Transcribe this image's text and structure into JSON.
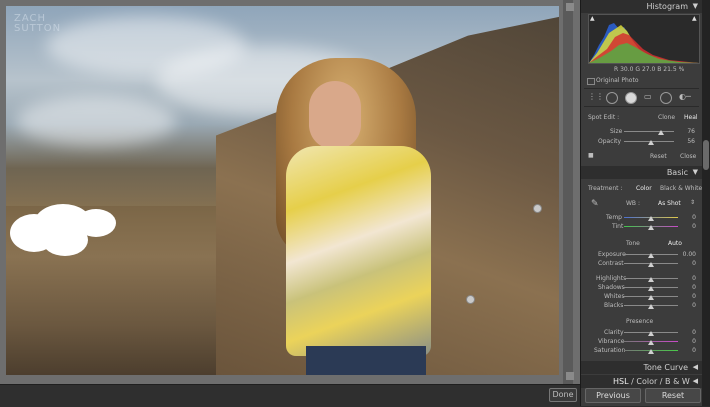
{
  "watermark": {
    "line1": "ZACH",
    "line2": "SUTTON"
  },
  "canvas": {
    "done_label": "Done"
  },
  "histogram": {
    "title": "Histogram",
    "readout": {
      "r_label": "R",
      "r_value": "30.0",
      "g_label": "G",
      "g_value": "27.0",
      "b_label": "B",
      "b_value": "21.5",
      "unit": "%"
    },
    "original_photo_label": "Original Photo"
  },
  "spot_edit": {
    "label": "Spot Edit :",
    "clone_label": "Clone",
    "heal_label": "Heal",
    "size_label": "Size",
    "size_value": "76",
    "size_level": 0.76,
    "opacity_label": "Opacity",
    "opacity_value": "56",
    "opacity_level": 0.56,
    "reset_label": "Reset",
    "close_label": "Close"
  },
  "basic": {
    "title": "Basic",
    "treatment_label": "Treatment :",
    "color_label": "Color",
    "bw_label": "Black & White",
    "wb_label": "WB :",
    "wb_value": "As Shot",
    "temp_label": "Temp",
    "temp_value": "0",
    "tint_label": "Tint",
    "tint_value": "0",
    "tone_label": "Tone",
    "auto_label": "Auto",
    "exposure_label": "Exposure",
    "exposure_value": "0.00",
    "contrast_label": "Contrast",
    "contrast_value": "0",
    "highlights_label": "Highlights",
    "highlights_value": "0",
    "shadows_label": "Shadows",
    "shadows_value": "0",
    "whites_label": "Whites",
    "whites_value": "0",
    "blacks_label": "Blacks",
    "blacks_value": "0",
    "presence_label": "Presence",
    "clarity_label": "Clarity",
    "clarity_value": "0",
    "vibrance_label": "Vibrance",
    "vibrance_value": "0",
    "saturation_label": "Saturation",
    "saturation_value": "0"
  },
  "tone_curve": {
    "title": "Tone Curve"
  },
  "hsl": {
    "hsl_label": "HSL",
    "sep1": "/",
    "color_label": "Color",
    "sep2": "/",
    "bw_label": "B & W"
  },
  "nav": {
    "previous_label": "Previous",
    "reset_label": "Reset"
  },
  "colors": {
    "panel_bg": "#3c3c3c",
    "header_bg": "#2e2e2e",
    "accent_white": "#ffffff"
  }
}
